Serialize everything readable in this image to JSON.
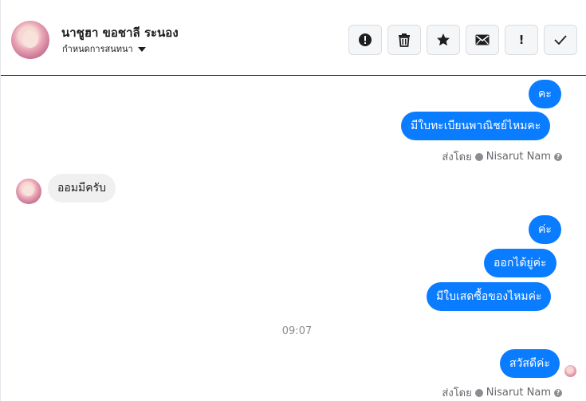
{
  "header": {
    "contact_name": "นาชูฮา ขอชาลี ระนอง",
    "subtitle": "กำหนดการสนทนา",
    "avatar_icon": "contact-avatar",
    "actions": [
      {
        "name": "spam-button",
        "icon": "exclamation-circle-icon"
      },
      {
        "name": "delete-button",
        "icon": "trash-icon"
      },
      {
        "name": "star-button",
        "icon": "star-icon"
      },
      {
        "name": "mark-unread-button",
        "icon": "envelope-icon"
      },
      {
        "name": "priority-button",
        "icon": "exclamation-icon",
        "label": "!"
      },
      {
        "name": "done-button",
        "icon": "check-icon"
      }
    ]
  },
  "messages": [
    {
      "direction": "out",
      "text": "คะ"
    },
    {
      "direction": "out",
      "text": "มีใบทะเบียนพาณิชย์ไหมคะ"
    },
    {
      "direction": "in",
      "text": "ออมมีครับ"
    },
    {
      "direction": "out",
      "text": "ค่ะ"
    },
    {
      "direction": "out",
      "text": "ออกได้ยู่ค่ะ"
    },
    {
      "direction": "out",
      "text": "มีใบเสดซื้อของไหมค่ะ"
    },
    {
      "direction": "out",
      "text": "สวัสดีค่ะ"
    }
  ],
  "sent_by": {
    "prefix": "ส่งโดย",
    "sender": "Nisarut Nam",
    "help": "?"
  },
  "timestamp": "09:07",
  "colors": {
    "outgoing_bubble": "#0a7cff",
    "incoming_bubble": "#f0f0f0",
    "meta_text": "#65676b"
  }
}
